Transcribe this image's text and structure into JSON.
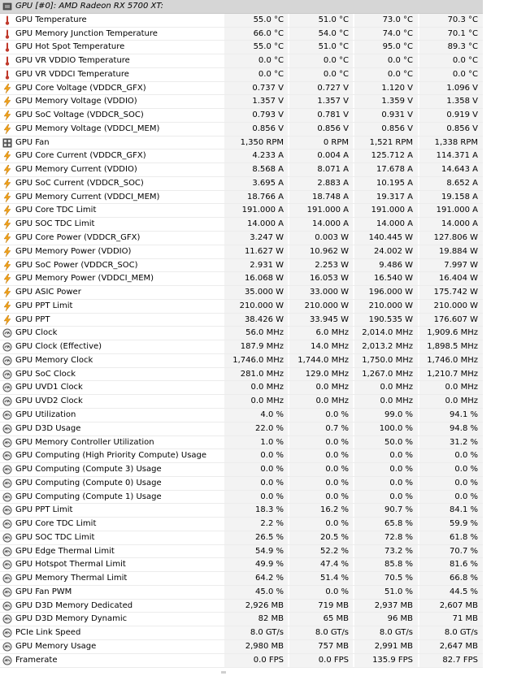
{
  "header": {
    "label": "GPU [#0]: AMD Radeon RX 5700 XT:"
  },
  "rows": [
    {
      "icon": "thermometer-icon",
      "name": "GPU Temperature",
      "v": [
        "55.0 °C",
        "51.0 °C",
        "73.0 °C",
        "70.3 °C"
      ]
    },
    {
      "icon": "thermometer-icon",
      "name": "GPU Memory Junction Temperature",
      "v": [
        "66.0 °C",
        "54.0 °C",
        "74.0 °C",
        "70.1 °C"
      ]
    },
    {
      "icon": "thermometer-icon",
      "name": "GPU Hot Spot Temperature",
      "v": [
        "55.0 °C",
        "51.0 °C",
        "95.0 °C",
        "89.3 °C"
      ]
    },
    {
      "icon": "thermometer-icon",
      "name": "GPU VR VDDIO Temperature",
      "v": [
        "0.0 °C",
        "0.0 °C",
        "0.0 °C",
        "0.0 °C"
      ]
    },
    {
      "icon": "thermometer-icon",
      "name": "GPU VR VDDCI Temperature",
      "v": [
        "0.0 °C",
        "0.0 °C",
        "0.0 °C",
        "0.0 °C"
      ]
    },
    {
      "icon": "bolt-icon",
      "name": "GPU Core Voltage (VDDCR_GFX)",
      "v": [
        "0.737 V",
        "0.727 V",
        "1.120 V",
        "1.096 V"
      ]
    },
    {
      "icon": "bolt-icon",
      "name": "GPU Memory Voltage (VDDIO)",
      "v": [
        "1.357 V",
        "1.357 V",
        "1.359 V",
        "1.358 V"
      ]
    },
    {
      "icon": "bolt-icon",
      "name": "GPU SoC Voltage (VDDCR_SOC)",
      "v": [
        "0.793 V",
        "0.781 V",
        "0.931 V",
        "0.919 V"
      ]
    },
    {
      "icon": "bolt-icon",
      "name": "GPU Memory Voltage (VDDCI_MEM)",
      "v": [
        "0.856 V",
        "0.856 V",
        "0.856 V",
        "0.856 V"
      ]
    },
    {
      "icon": "fan-icon",
      "name": "GPU Fan",
      "v": [
        "1,350 RPM",
        "0 RPM",
        "1,521 RPM",
        "1,338 RPM"
      ]
    },
    {
      "icon": "bolt-icon",
      "name": "GPU Core Current (VDDCR_GFX)",
      "v": [
        "4.233 A",
        "0.004 A",
        "125.712 A",
        "114.371 A"
      ]
    },
    {
      "icon": "bolt-icon",
      "name": "GPU Memory Current (VDDIO)",
      "v": [
        "8.568 A",
        "8.071 A",
        "17.678 A",
        "14.643 A"
      ]
    },
    {
      "icon": "bolt-icon",
      "name": "GPU SoC Current (VDDCR_SOC)",
      "v": [
        "3.695 A",
        "2.883 A",
        "10.195 A",
        "8.652 A"
      ]
    },
    {
      "icon": "bolt-icon",
      "name": "GPU Memory Current (VDDCI_MEM)",
      "v": [
        "18.766 A",
        "18.748 A",
        "19.317 A",
        "19.158 A"
      ]
    },
    {
      "icon": "bolt-icon",
      "name": "GPU Core TDC Limit",
      "v": [
        "191.000 A",
        "191.000 A",
        "191.000 A",
        "191.000 A"
      ]
    },
    {
      "icon": "bolt-icon",
      "name": "GPU SOC TDC Limit",
      "v": [
        "14.000 A",
        "14.000 A",
        "14.000 A",
        "14.000 A"
      ]
    },
    {
      "icon": "bolt-icon",
      "name": "GPU Core Power (VDDCR_GFX)",
      "v": [
        "3.247 W",
        "0.003 W",
        "140.445 W",
        "127.806 W"
      ]
    },
    {
      "icon": "bolt-icon",
      "name": "GPU Memory Power (VDDIO)",
      "v": [
        "11.627 W",
        "10.962 W",
        "24.002 W",
        "19.884 W"
      ]
    },
    {
      "icon": "bolt-icon",
      "name": "GPU SoC Power (VDDCR_SOC)",
      "v": [
        "2.931 W",
        "2.253 W",
        "9.486 W",
        "7.997 W"
      ]
    },
    {
      "icon": "bolt-icon",
      "name": "GPU Memory Power (VDDCI_MEM)",
      "v": [
        "16.068 W",
        "16.053 W",
        "16.540 W",
        "16.404 W"
      ]
    },
    {
      "icon": "bolt-icon",
      "name": "GPU ASIC Power",
      "v": [
        "35.000 W",
        "33.000 W",
        "196.000 W",
        "175.742 W"
      ]
    },
    {
      "icon": "bolt-icon",
      "name": "GPU PPT Limit",
      "v": [
        "210.000 W",
        "210.000 W",
        "210.000 W",
        "210.000 W"
      ]
    },
    {
      "icon": "bolt-icon",
      "name": "GPU PPT",
      "v": [
        "38.426 W",
        "33.945 W",
        "190.535 W",
        "176.607 W"
      ]
    },
    {
      "icon": "clock-icon",
      "name": "GPU Clock",
      "v": [
        "56.0 MHz",
        "6.0 MHz",
        "2,014.0 MHz",
        "1,909.6 MHz"
      ]
    },
    {
      "icon": "clock-icon",
      "name": "GPU Clock (Effective)",
      "v": [
        "187.9 MHz",
        "14.0 MHz",
        "2,013.2 MHz",
        "1,898.5 MHz"
      ]
    },
    {
      "icon": "clock-icon",
      "name": "GPU Memory Clock",
      "v": [
        "1,746.0 MHz",
        "1,744.0 MHz",
        "1,750.0 MHz",
        "1,746.0 MHz"
      ]
    },
    {
      "icon": "clock-icon",
      "name": "GPU SoC Clock",
      "v": [
        "281.0 MHz",
        "129.0 MHz",
        "1,267.0 MHz",
        "1,210.7 MHz"
      ]
    },
    {
      "icon": "clock-icon",
      "name": "GPU UVD1 Clock",
      "v": [
        "0.0 MHz",
        "0.0 MHz",
        "0.0 MHz",
        "0.0 MHz"
      ]
    },
    {
      "icon": "clock-icon",
      "name": "GPU UVD2 Clock",
      "v": [
        "0.0 MHz",
        "0.0 MHz",
        "0.0 MHz",
        "0.0 MHz"
      ]
    },
    {
      "icon": "gauge-icon",
      "name": "GPU Utilization",
      "v": [
        "4.0 %",
        "0.0 %",
        "99.0 %",
        "94.1 %"
      ]
    },
    {
      "icon": "gauge-icon",
      "name": "GPU D3D Usage",
      "v": [
        "22.0 %",
        "0.7 %",
        "100.0 %",
        "94.8 %"
      ]
    },
    {
      "icon": "gauge-icon",
      "name": "GPU Memory Controller Utilization",
      "v": [
        "1.0 %",
        "0.0 %",
        "50.0 %",
        "31.2 %"
      ]
    },
    {
      "icon": "gauge-icon",
      "name": "GPU Computing (High Priority Compute) Usage",
      "v": [
        "0.0 %",
        "0.0 %",
        "0.0 %",
        "0.0 %"
      ]
    },
    {
      "icon": "gauge-icon",
      "name": "GPU Computing (Compute 3) Usage",
      "v": [
        "0.0 %",
        "0.0 %",
        "0.0 %",
        "0.0 %"
      ]
    },
    {
      "icon": "gauge-icon",
      "name": "GPU Computing (Compute 0) Usage",
      "v": [
        "0.0 %",
        "0.0 %",
        "0.0 %",
        "0.0 %"
      ]
    },
    {
      "icon": "gauge-icon",
      "name": "GPU Computing (Compute 1) Usage",
      "v": [
        "0.0 %",
        "0.0 %",
        "0.0 %",
        "0.0 %"
      ]
    },
    {
      "icon": "gauge-icon",
      "name": "GPU PPT Limit",
      "v": [
        "18.3 %",
        "16.2 %",
        "90.7 %",
        "84.1 %"
      ]
    },
    {
      "icon": "gauge-icon",
      "name": "GPU Core TDC Limit",
      "v": [
        "2.2 %",
        "0.0 %",
        "65.8 %",
        "59.9 %"
      ]
    },
    {
      "icon": "gauge-icon",
      "name": "GPU SOC TDC Limit",
      "v": [
        "26.5 %",
        "20.5 %",
        "72.8 %",
        "61.8 %"
      ]
    },
    {
      "icon": "gauge-icon",
      "name": "GPU Edge Thermal Limit",
      "v": [
        "54.9 %",
        "52.2 %",
        "73.2 %",
        "70.7 %"
      ]
    },
    {
      "icon": "gauge-icon",
      "name": "GPU Hotspot Thermal Limit",
      "v": [
        "49.9 %",
        "47.4 %",
        "85.8 %",
        "81.6 %"
      ]
    },
    {
      "icon": "gauge-icon",
      "name": "GPU Memory Thermal Limit",
      "v": [
        "64.2 %",
        "51.4 %",
        "70.5 %",
        "66.8 %"
      ]
    },
    {
      "icon": "gauge-icon",
      "name": "GPU Fan PWM",
      "v": [
        "45.0 %",
        "0.0 %",
        "51.0 %",
        "44.5 %"
      ]
    },
    {
      "icon": "gauge-icon",
      "name": "GPU D3D Memory Dedicated",
      "v": [
        "2,926 MB",
        "719 MB",
        "2,937 MB",
        "2,607 MB"
      ]
    },
    {
      "icon": "gauge-icon",
      "name": "GPU D3D Memory Dynamic",
      "v": [
        "82 MB",
        "65 MB",
        "96 MB",
        "71 MB"
      ]
    },
    {
      "icon": "gauge-icon",
      "name": "PCIe Link Speed",
      "v": [
        "8.0 GT/s",
        "8.0 GT/s",
        "8.0 GT/s",
        "8.0 GT/s"
      ]
    },
    {
      "icon": "gauge-icon",
      "name": "GPU Memory Usage",
      "v": [
        "2,980 MB",
        "757 MB",
        "2,991 MB",
        "2,647 MB"
      ]
    },
    {
      "icon": "gauge-icon",
      "name": "Framerate",
      "v": [
        "0.0 FPS",
        "0.0 FPS",
        "135.9 FPS",
        "82.7 FPS"
      ]
    }
  ]
}
